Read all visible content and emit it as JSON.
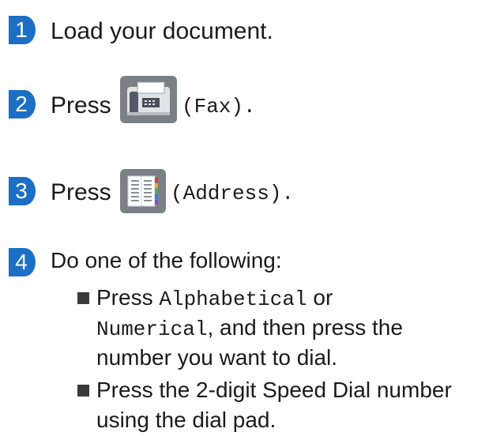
{
  "steps": [
    {
      "number": "1",
      "text": "Load your document."
    },
    {
      "number": "2",
      "press": "Press",
      "button": "(Fax).",
      "icon": "fax-icon",
      "button_label": "Fax"
    },
    {
      "number": "3",
      "press": "Press",
      "button": "(Address).",
      "icon": "address-book-icon",
      "button_label": "Address"
    },
    {
      "number": "4",
      "text": "Do one of the following:"
    }
  ],
  "bullets": [
    {
      "pre": "Press ",
      "opt1": "Alphabetical",
      "mid": " or",
      "opt2": "Numerical",
      "post": ", and then press the",
      "line3": "number you want to dial."
    },
    {
      "line1": "Press the 2-digit Speed Dial number",
      "line2": "using the dial pad."
    }
  ],
  "colors": {
    "step_badge": "#1c6fc4",
    "button_bg": "#7b8087"
  }
}
